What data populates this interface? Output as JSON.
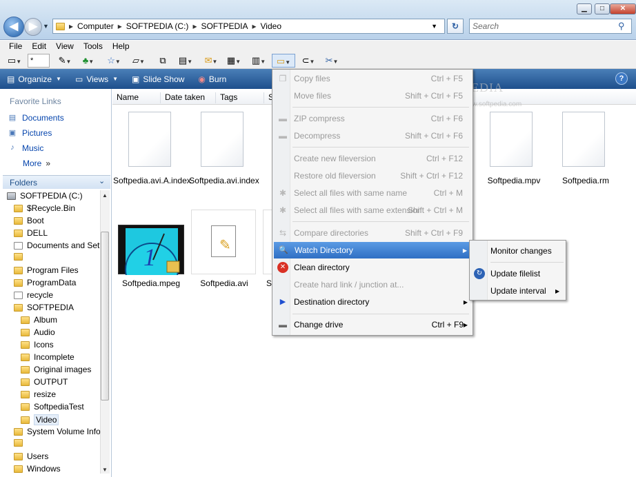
{
  "window": {
    "min_label": "▁",
    "max_label": "□",
    "close_label": "✕"
  },
  "address": {
    "crumbs": [
      "Computer",
      "SOFTPEDIA (C:)",
      "SOFTPEDIA",
      "Video"
    ],
    "separator": "▸",
    "search_placeholder": "Search"
  },
  "menubar": [
    "File",
    "Edit",
    "View",
    "Tools",
    "Help"
  ],
  "toolbar": {
    "size_value": "*"
  },
  "cmdbar": {
    "organize": "Organize",
    "views": "Views",
    "slideshow": "Slide Show",
    "burn": "Burn",
    "help": "?"
  },
  "sidebar": {
    "favorites_title": "Favorite Links",
    "favorites": [
      "Documents",
      "Pictures",
      "Music"
    ],
    "more": "More",
    "more_chevron": "»",
    "folders_title": "Folders",
    "tree": [
      {
        "label": "SOFTPEDIA (C:)",
        "level": 0,
        "kind": "drive"
      },
      {
        "label": "$Recycle.Bin",
        "level": 1,
        "kind": "folder"
      },
      {
        "label": "Boot",
        "level": 1,
        "kind": "folder"
      },
      {
        "label": "DELL",
        "level": 1,
        "kind": "folder"
      },
      {
        "label": "Documents and Settings",
        "level": 1,
        "kind": "shortcut"
      },
      {
        "label": "",
        "level": 1,
        "kind": "folder"
      },
      {
        "label": "Program Files",
        "level": 1,
        "kind": "folder"
      },
      {
        "label": "ProgramData",
        "level": 1,
        "kind": "folder"
      },
      {
        "label": "recycle",
        "level": 1,
        "kind": "shortcut"
      },
      {
        "label": "SOFTPEDIA",
        "level": 1,
        "kind": "folder"
      },
      {
        "label": "Album",
        "level": 2,
        "kind": "folder"
      },
      {
        "label": "Audio",
        "level": 2,
        "kind": "folder"
      },
      {
        "label": "Icons",
        "level": 2,
        "kind": "folder"
      },
      {
        "label": "Incomplete",
        "level": 2,
        "kind": "folder"
      },
      {
        "label": "Original images",
        "level": 2,
        "kind": "folder"
      },
      {
        "label": "OUTPUT",
        "level": 2,
        "kind": "folder"
      },
      {
        "label": "resize",
        "level": 2,
        "kind": "folder"
      },
      {
        "label": "SoftpediaTest",
        "level": 2,
        "kind": "folder"
      },
      {
        "label": "Video",
        "level": 2,
        "kind": "folder",
        "selected": true
      },
      {
        "label": "System Volume Information",
        "level": 1,
        "kind": "folder"
      },
      {
        "label": "",
        "level": 1,
        "kind": "folder"
      },
      {
        "label": "Users",
        "level": 1,
        "kind": "folder"
      },
      {
        "label": "Windows",
        "level": 1,
        "kind": "folder"
      }
    ]
  },
  "columns": [
    "Name",
    "Date taken",
    "Tags",
    "S"
  ],
  "files": [
    {
      "name": "Softpedia.avi.A.index",
      "kind": "blank"
    },
    {
      "name": "Softpedia.avi.index",
      "kind": "blank"
    },
    {
      "name": "Softpedia.mpv",
      "kind": "blank"
    },
    {
      "name": "Softpedia.rm",
      "kind": "blank"
    },
    {
      "name": "Softpedia.mpeg",
      "kind": "video"
    },
    {
      "name": "Softpedia.avi",
      "kind": "avi"
    },
    {
      "name": "S",
      "kind": "partial"
    }
  ],
  "context_menu": {
    "items": [
      {
        "label": "Copy files",
        "shortcut": "Ctrl + F5",
        "disabled": true,
        "icon": "copy-files-icon"
      },
      {
        "label": "Move files",
        "shortcut": "Shift + Ctrl + F5",
        "disabled": true,
        "icon": ""
      },
      {
        "label": "ZIP compress",
        "shortcut": "Ctrl + F6",
        "disabled": true,
        "icon": "zip-icon"
      },
      {
        "label": "Decompress",
        "shortcut": "Shift + Ctrl + F6",
        "disabled": true,
        "icon": "decompress-icon"
      },
      {
        "label": "Create new fileversion",
        "shortcut": "Ctrl + F12",
        "disabled": true,
        "icon": ""
      },
      {
        "label": "Restore old fileversion",
        "shortcut": "Shift + Ctrl + F12",
        "disabled": true,
        "icon": ""
      },
      {
        "label": "Select all files with same name",
        "shortcut": "Ctrl + M",
        "disabled": true,
        "icon": "select-same-name-icon"
      },
      {
        "label": "Select all files with same extension",
        "shortcut": "Shift + Ctrl + M",
        "disabled": true,
        "icon": "select-same-ext-icon"
      },
      {
        "label": "Compare directories",
        "shortcut": "Shift + Ctrl + F9",
        "disabled": true,
        "icon": "compare-icon"
      },
      {
        "label": "Watch Directory",
        "shortcut": "",
        "disabled": false,
        "icon": "magnifier-icon",
        "submenu": true,
        "highlighted": true
      },
      {
        "label": "Clean directory",
        "shortcut": "",
        "disabled": false,
        "icon": "clean-icon"
      },
      {
        "label": "Create hard link / junction at...",
        "shortcut": "",
        "disabled": true,
        "icon": ""
      },
      {
        "label": "Destination directory",
        "shortcut": "",
        "disabled": false,
        "icon": "arrow-icon",
        "submenu": true
      },
      {
        "label": "Change drive",
        "shortcut": "Ctrl + F9",
        "disabled": false,
        "icon": "drive-icon",
        "submenu": true
      }
    ],
    "submenu_arrow": "▶"
  },
  "submenu": {
    "items": [
      {
        "label": "Monitor changes",
        "submenu": false
      },
      {
        "label": "Update filelist",
        "submenu": false
      },
      {
        "label": "Update interval",
        "submenu": true
      }
    ]
  },
  "watermark": {
    "main": "SOFTPEDIA",
    "sub": "www.softpedia.com"
  },
  "colors": {
    "accent": "#2f6fc4",
    "cmdbar": "#1e4f8c",
    "disabled": "#9a9a9a"
  }
}
